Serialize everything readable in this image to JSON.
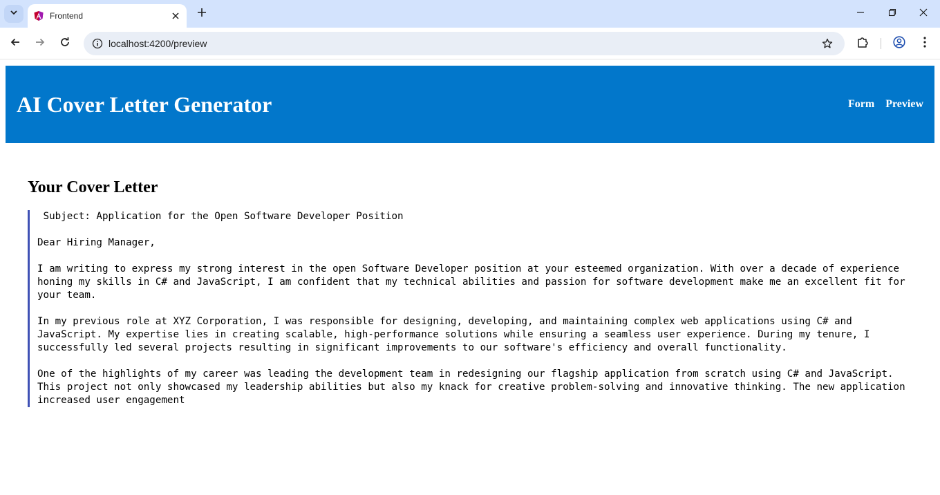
{
  "browser": {
    "tab_title": "Frontend",
    "url": "localhost:4200/preview",
    "icons": {
      "tab_search": "chevron-down-icon",
      "favicon": "angular-logo-icon",
      "tab_close": "close-icon",
      "new_tab": "plus-icon",
      "back": "arrow-left-icon",
      "forward": "arrow-right-icon",
      "reload": "reload-icon",
      "site_info": "info-icon",
      "bookmark": "star-icon",
      "extensions": "puzzle-icon",
      "profile": "profile-icon",
      "menu": "kebab-menu-icon"
    }
  },
  "header": {
    "title": "AI Cover Letter Generator",
    "nav": [
      {
        "label": "Form"
      },
      {
        "label": "Preview"
      }
    ],
    "background_color": "#0277cb"
  },
  "main": {
    "section_title": "Your Cover Letter",
    "letter_text": " Subject: Application for the Open Software Developer Position\n\nDear Hiring Manager,\n\nI am writing to express my strong interest in the open Software Developer position at your esteemed organization. With over a decade of experience honing my skills in C# and JavaScript, I am confident that my technical abilities and passion for software development make me an excellent fit for your team.\n\nIn my previous role at XYZ Corporation, I was responsible for designing, developing, and maintaining complex web applications using C# and JavaScript. My expertise lies in creating scalable, high-performance solutions while ensuring a seamless user experience. During my tenure, I successfully led several projects resulting in significant improvements to our software's efficiency and overall functionality.\n\nOne of the highlights of my career was leading the development team in redesigning our flagship application from scratch using C# and JavaScript. This project not only showcased my leadership abilities but also my knack for creative problem-solving and innovative thinking. The new application increased user engagement",
    "accent_color": "#3f51b5"
  }
}
